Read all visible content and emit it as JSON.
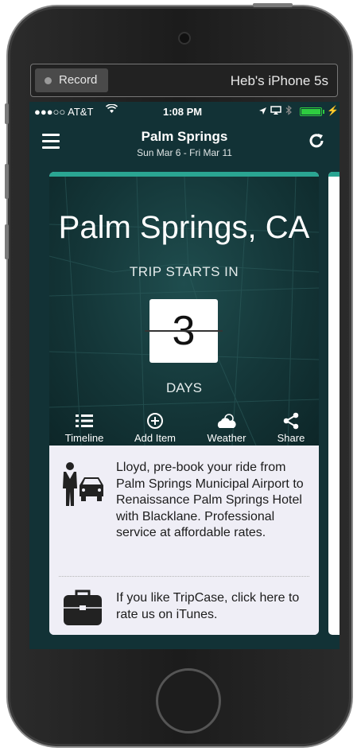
{
  "recorder": {
    "button_label": "Record",
    "device_name": "Heb's iPhone 5s"
  },
  "status_bar": {
    "carrier": "●●●○○ AT&T",
    "time": "1:08 PM"
  },
  "nav": {
    "title": "Palm Springs",
    "subtitle": "Sun Mar 6 - Fri Mar 11",
    "menu_icon": "hamburger-icon",
    "refresh_icon": "refresh-icon"
  },
  "trip": {
    "city": "Palm Springs, CA",
    "starts_label": "TRIP STARTS IN",
    "days_count": "3",
    "days_label": "DAYS"
  },
  "actions": [
    {
      "label": "Timeline",
      "icon": "list-icon"
    },
    {
      "label": "Add Item",
      "icon": "plus-circle-icon"
    },
    {
      "label": "Weather",
      "icon": "cloud-sun-icon"
    },
    {
      "label": "Share",
      "icon": "share-icon"
    }
  ],
  "promo": {
    "text": "Lloyd, pre-book your ride from Palm Springs Municipal Airport to Renaissance Palm Springs Hotel with Blacklane. Professional service at affordable rates.",
    "icon": "chauffeur-car-icon"
  },
  "rate": {
    "text": "If you like TripCase, click here to rate us on iTunes.",
    "icon": "briefcase-icon"
  },
  "colors": {
    "accent": "#2aa592",
    "hero_bg": "#143638",
    "card_bg": "#efeef6"
  }
}
